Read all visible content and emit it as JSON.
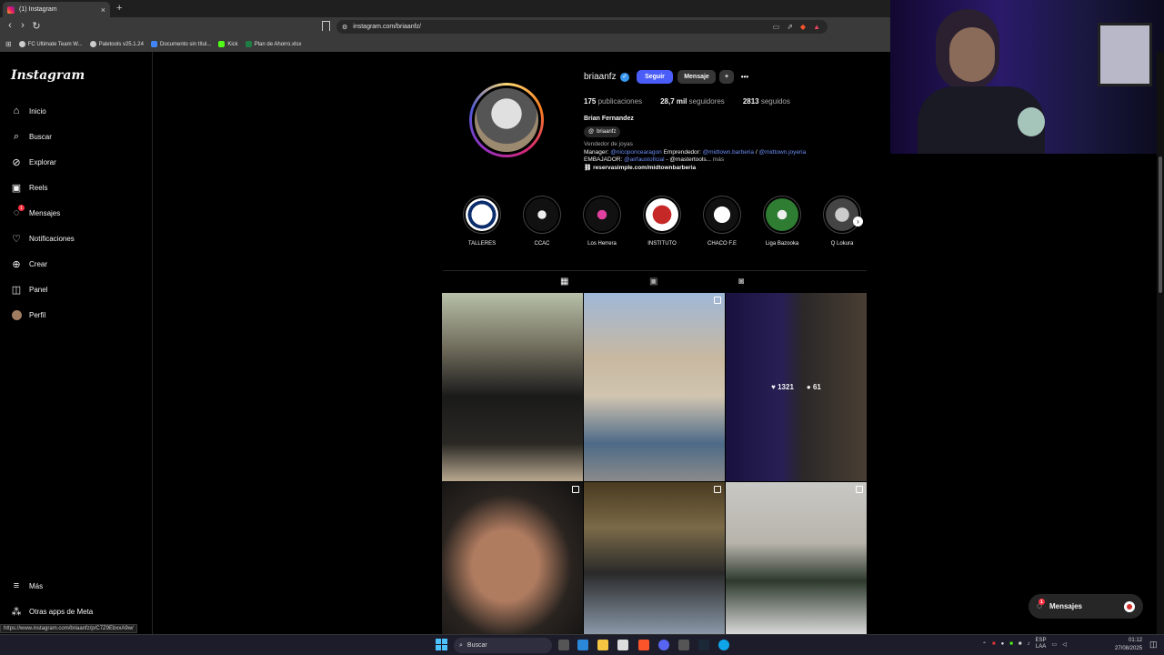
{
  "browser": {
    "tab_title": "(1) Instagram",
    "new_tab": "+",
    "url": "instagram.com/briaanfz/",
    "bookmarks": [
      "FC Ultimate Team W...",
      "Paletools v25.1.24",
      "Documento sin títul...",
      "Kick",
      "Plan de Ahorro.xlsx"
    ]
  },
  "sidebar": {
    "logo": "Instagram",
    "items": [
      {
        "label": "Inicio",
        "icon": "home-icon"
      },
      {
        "label": "Buscar",
        "icon": "search-icon"
      },
      {
        "label": "Explorar",
        "icon": "compass-icon"
      },
      {
        "label": "Reels",
        "icon": "reels-icon"
      },
      {
        "label": "Mensajes",
        "icon": "messenger-icon",
        "badge": "1"
      },
      {
        "label": "Notificaciones",
        "icon": "heart-icon"
      },
      {
        "label": "Crear",
        "icon": "plus-icon"
      },
      {
        "label": "Panel",
        "icon": "chart-icon"
      },
      {
        "label": "Perfil",
        "icon": "avatar-icon"
      }
    ],
    "more": "Más",
    "meta": "Otras apps de Meta"
  },
  "profile": {
    "username": "briaanfz",
    "follow": "Seguir",
    "message": "Mensaje",
    "add_person": "+",
    "more": "•••",
    "posts_count": "175",
    "posts_label": "publicaciones",
    "followers_count": "28,7 mil",
    "followers_label": "seguidores",
    "following_count": "2813",
    "following_label": "seguidos",
    "full_name": "Brian Fernandez",
    "threads": "briaanfz",
    "category": "Vendedor de joyas",
    "bio1_a": "Manager: ",
    "bio1_b": "@nicoponcearagon",
    "bio1_c": " Emprendedor: ",
    "bio1_d": "@midtown.barberia",
    "bio1_e": " / ",
    "bio1_f": "@midtown.joyeria",
    "bio2_a": "EMBAJADOR: ",
    "bio2_b": "@airfaustoficial",
    "bio2_c": " - @mastertools...",
    "bio2_more": " más",
    "link": "reservasimple.com/midtownbarberia"
  },
  "highlights": [
    "TALLERES",
    "CCAC",
    "Los Herrera",
    "INSTITUTO",
    "CHACO F.E",
    "Liga Bazooka",
    "Q Lokura"
  ],
  "post_overlay": {
    "likes": "1321",
    "comments": "61"
  },
  "messages_bubble": {
    "label": "Mensajes",
    "badge": "1"
  },
  "status_url": "https://www.instagram.com/briaanfz/p/C7Z9EbxxA9w/",
  "taskbar": {
    "search": "Buscar",
    "lang1": "ESP",
    "lang2": "LAA",
    "time": "01:12",
    "date": "27/08/2025"
  }
}
